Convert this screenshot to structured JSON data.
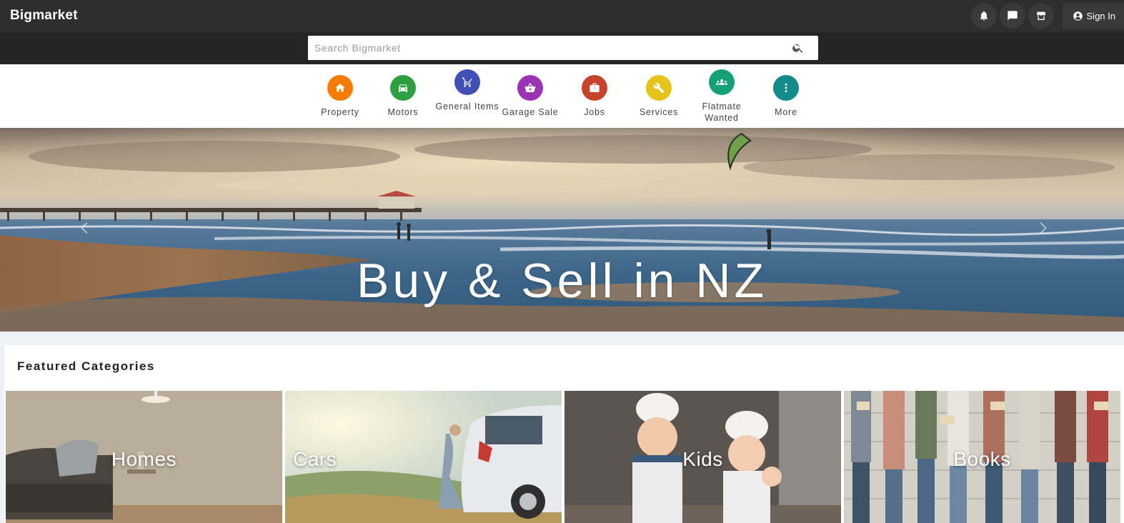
{
  "header": {
    "brand": "Bigmarket",
    "actions": [
      {
        "icon": "bell-icon"
      },
      {
        "icon": "chat-icon"
      },
      {
        "icon": "store-icon"
      }
    ],
    "signin_label": "Sign In"
  },
  "search": {
    "placeholder": "Search Bigmarket"
  },
  "categories": [
    {
      "label": "Property",
      "icon": "home-icon",
      "color": "#f57c00"
    },
    {
      "label": "Motors",
      "icon": "car-icon",
      "color": "#2ea043"
    },
    {
      "label": "General Items",
      "icon": "cart-icon",
      "color": "#3f4fb5"
    },
    {
      "label": "Garage Sale",
      "icon": "basket-icon",
      "color": "#9b33b5"
    },
    {
      "label": "Jobs",
      "icon": "briefcase-icon",
      "color": "#c6432c"
    },
    {
      "label": "Services",
      "icon": "wrench-icon",
      "color": "#e6c21a"
    },
    {
      "label": "Flatmate Wanted",
      "icon": "group-icon",
      "color": "#16a077"
    },
    {
      "label": "More",
      "icon": "more-vertical-icon",
      "color": "#138b8b"
    }
  ],
  "hero": {
    "title": "Buy & Sell in NZ"
  },
  "featured": {
    "title": "Featured Categories",
    "tiles": [
      {
        "label": "Homes"
      },
      {
        "label": "Cars"
      },
      {
        "label": "Kids"
      },
      {
        "label": "Books"
      }
    ]
  }
}
